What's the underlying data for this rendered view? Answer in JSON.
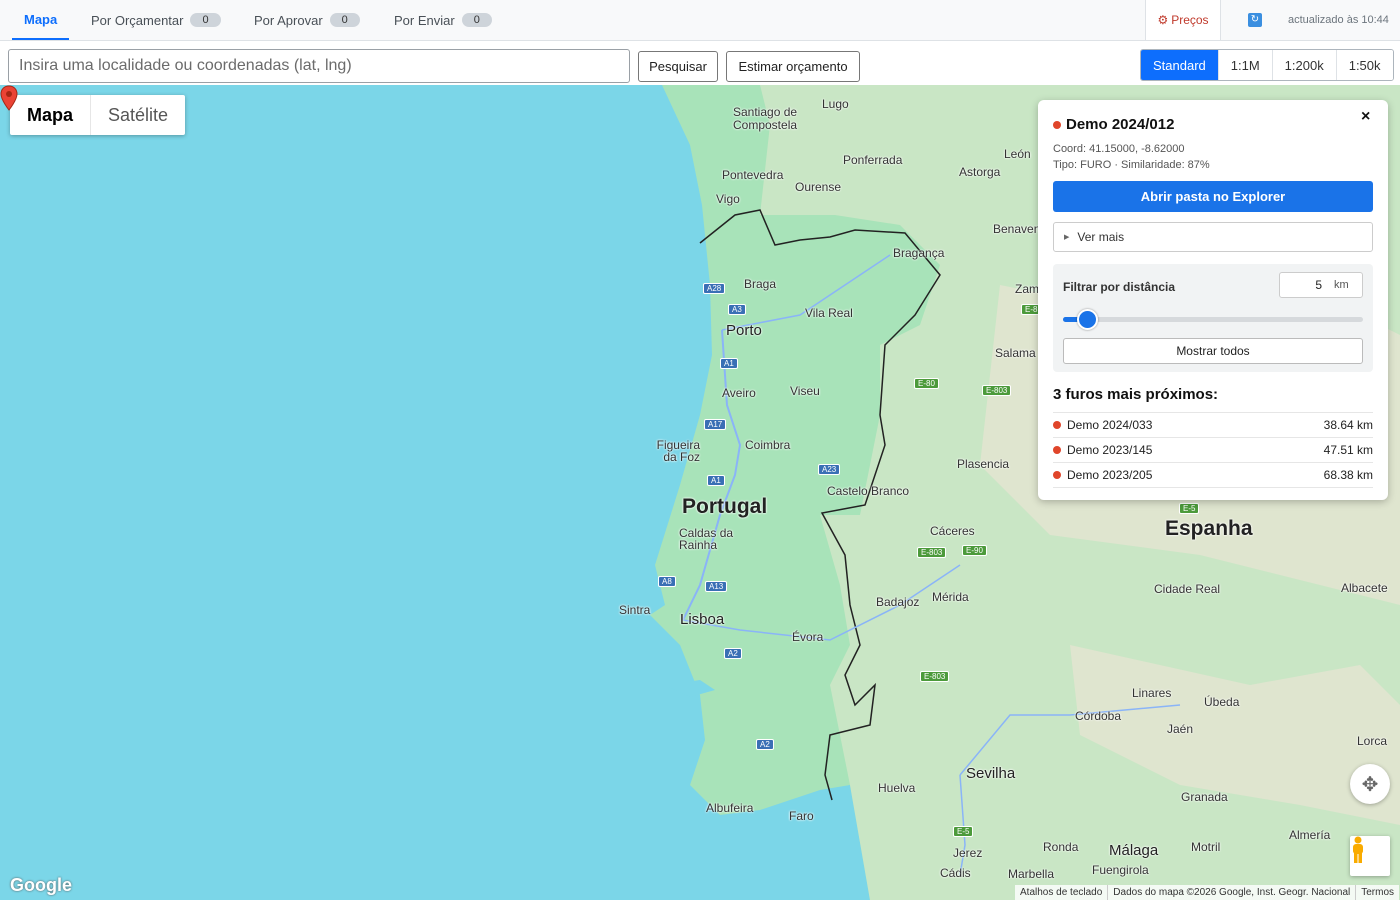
{
  "tabs": [
    {
      "label": "Mapa",
      "badge": null
    },
    {
      "label": "Por Orçamentar",
      "badge": "0"
    },
    {
      "label": "Por Aprovar",
      "badge": "0"
    },
    {
      "label": "Por Enviar",
      "badge": "0"
    }
  ],
  "header": {
    "precos_label": "Preços",
    "precos_icon": "gear-icon",
    "refresh_icon": "refresh-icon",
    "updated_text": "actualizado às 10:44"
  },
  "search": {
    "placeholder": "Insira uma localidade ou coordenadas (lat, lng)",
    "value": "",
    "search_button": "Pesquisar",
    "estimate_button": "Estimar orçamento"
  },
  "scale_options": [
    "Standard",
    "1:1M",
    "1:200k",
    "1:50k"
  ],
  "scale_selected": "Standard",
  "map": {
    "types": [
      "Mapa",
      "Satélite"
    ],
    "selected_type": "Mapa",
    "logo": "Google",
    "footer": [
      "Atalhos de teclado",
      "Dados do mapa ©2026 Google, Inst. Geogr. Nacional",
      "Termos"
    ],
    "labels": {
      "santiago": "Santiago de Compostela",
      "lugo": "Lugo",
      "ponferrada": "Ponferrada",
      "leon": "León",
      "astorga": "Astorga",
      "pontevedra": "Pontevedra",
      "ourense": "Ourense",
      "vigo": "Vigo",
      "benavente": "Benaven",
      "braganca": "Bragança",
      "braga": "Braga",
      "zamora": "Zamora",
      "vilareal": "Vila Real",
      "porto": "Porto",
      "salamanca": "Salama",
      "aveiro": "Aveiro",
      "viseu": "Viseu",
      "figueira": "Figueira da Foz",
      "coimbra": "Coimbra",
      "plasencia": "Plasencia",
      "castelobranco": "Castelo Branco",
      "portugal": "Portugal",
      "espanha": "Espanha",
      "caldas": "Caldas da Rainha",
      "caceres": "Cáceres",
      "sintra": "Sintra",
      "lisboa": "Lisboa",
      "badajoz": "Badajoz",
      "merida": "Mérida",
      "ciudadreal": "Cidade Real",
      "albacete": "Albacete",
      "evora": "Évora",
      "linares": "Linares",
      "ubeda": "Úbeda",
      "cordoba": "Córdoba",
      "jaen": "Jaén",
      "lorca": "Lorca",
      "sevilha": "Sevilha",
      "huelva": "Huelva",
      "granada": "Granada",
      "albufeira": "Albufeira",
      "faro": "Faro",
      "almeria": "Almería",
      "jerez": "Jerez",
      "ronda": "Ronda",
      "malaga": "Málaga",
      "motril": "Motril",
      "cadis": "Cádis",
      "marbella": "Marbella",
      "fuengirola": "Fuengirola"
    },
    "roads": [
      "A28",
      "A3",
      "A1",
      "A17",
      "A23",
      "A1",
      "A8",
      "A13",
      "A2",
      "A2",
      "E-80",
      "E-803",
      "E-803",
      "E-90",
      "E-803",
      "E-5",
      "E-5",
      "E-8"
    ]
  },
  "panel": {
    "title": "Demo 2024/012",
    "coord": "Coord: 41.15000, -8.62000",
    "tipo": "Tipo: FURO · Similaridade: 87%",
    "open_button": "Abrir pasta no Explorer",
    "details_label": "Ver mais",
    "filter_label": "Filtrar por distância",
    "distance_value": "5",
    "distance_unit": "km",
    "slider_fraction": 0.08,
    "show_all": "Mostrar todos",
    "nearest_title": "3 furos mais próximos:",
    "nearest": [
      {
        "name": "Demo 2024/033",
        "distance": "38.64 km"
      },
      {
        "name": "Demo 2023/145",
        "distance": "47.51 km"
      },
      {
        "name": "Demo 2023/205",
        "distance": "68.38 km"
      }
    ],
    "dot_color": "#e0452a",
    "accent_color": "#1a73e8"
  }
}
